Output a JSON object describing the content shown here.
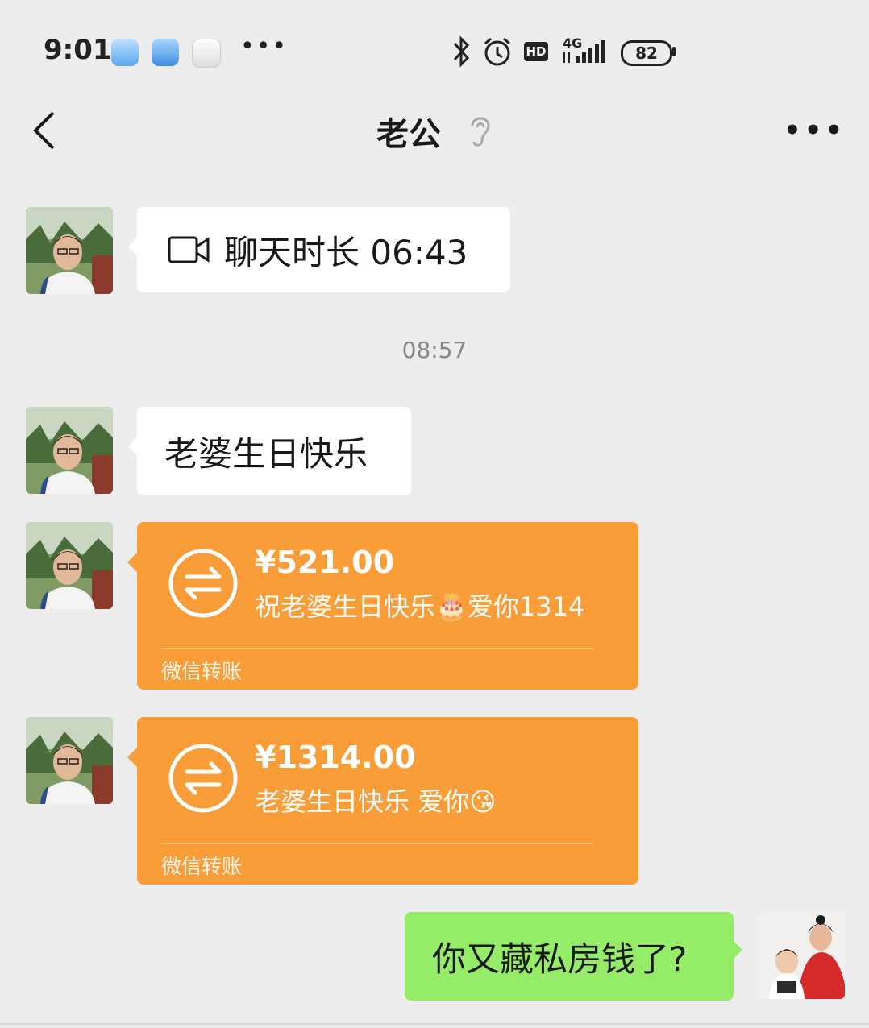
{
  "status_bar": {
    "time": "9:01",
    "network": "4G",
    "hd_label": "HD",
    "battery": "82",
    "overflow": "•••"
  },
  "header": {
    "title": "老公",
    "back_icon": "chevron-left-icon",
    "mode_icon": "ear-icon",
    "more_label": "•••"
  },
  "messages": [
    {
      "type": "video_call",
      "side": "left",
      "text": "聊天时长 06:43"
    },
    {
      "type": "timestamp",
      "text": "08:57"
    },
    {
      "type": "text",
      "side": "left",
      "text": "老婆生日快乐"
    },
    {
      "type": "transfer",
      "side": "left",
      "amount": "¥521.00",
      "memo": "祝老婆生日快乐🎂爱你1314",
      "footer": "微信转账"
    },
    {
      "type": "transfer",
      "side": "left",
      "amount": "¥1314.00",
      "memo": "老婆生日快乐 爱你😘",
      "footer": "微信转账"
    },
    {
      "type": "text",
      "side": "right",
      "text": "你又藏私房钱了?"
    }
  ],
  "colors": {
    "background": "#ededed",
    "bubble_white": "#ffffff",
    "bubble_green": "#95ec69",
    "transfer_orange": "#f99d39"
  }
}
